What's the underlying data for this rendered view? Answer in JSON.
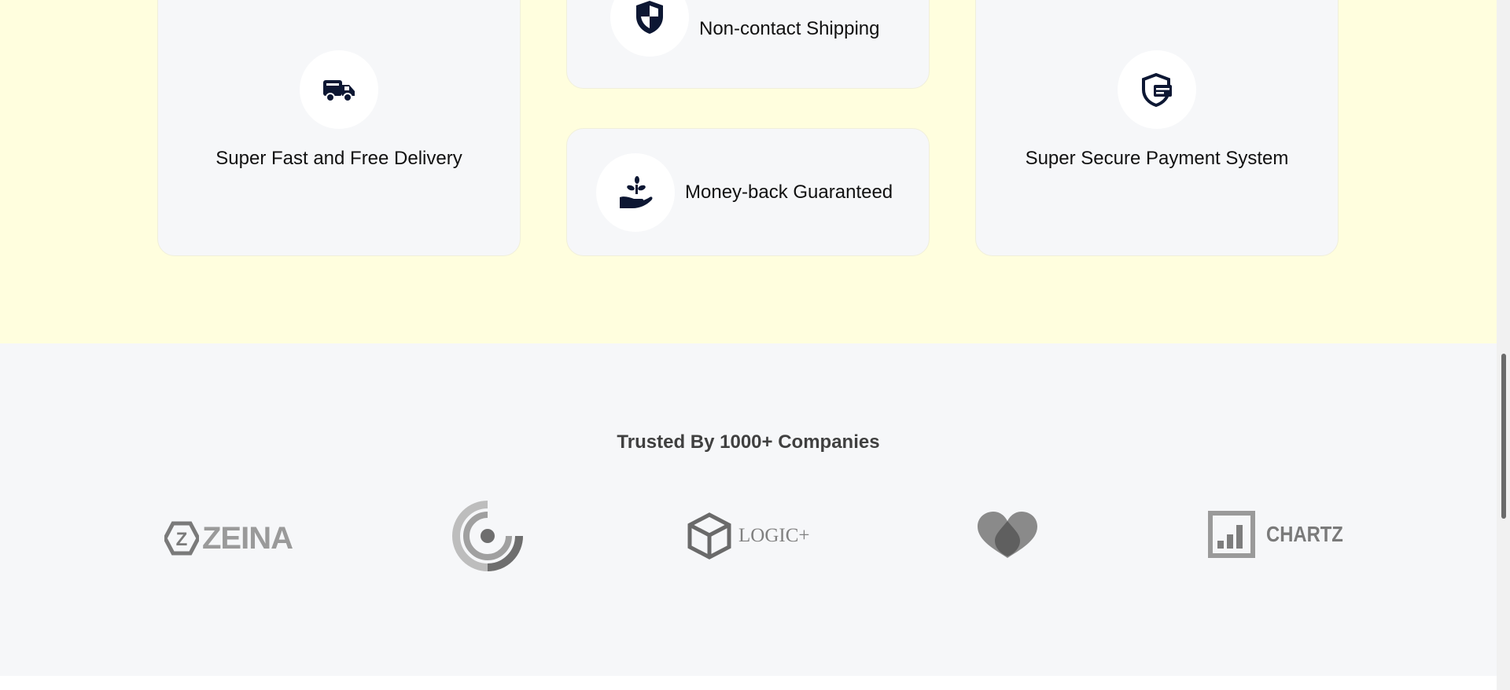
{
  "features": {
    "background_color": "#fffede",
    "cards": [
      {
        "label": "Super Fast and Free Delivery",
        "icon": "delivery-truck-icon"
      },
      {
        "label": "Non-contact Shipping",
        "icon": "shield-icon"
      },
      {
        "label": "Money-back Guaranteed",
        "icon": "hand-plant-icon"
      },
      {
        "label": "Super Secure Payment System",
        "icon": "secure-payment-icon"
      }
    ]
  },
  "trusted": {
    "title": "Trusted By 1000+ Companies",
    "logos": [
      {
        "name": "ZEINA",
        "icon": "zeina-logo-icon"
      },
      {
        "name": "",
        "icon": "target-ring-logo-icon"
      },
      {
        "name": "LOGIC+",
        "icon": "logic-cube-logo-icon"
      },
      {
        "name": "",
        "icon": "heart-logo-icon"
      },
      {
        "name": "CHARTZ",
        "icon": "chartz-logo-icon"
      }
    ]
  },
  "colors": {
    "icon_dark": "#0d1733",
    "logo_gray": "#8a8a8a",
    "section_gray": "#f6f7f9"
  }
}
